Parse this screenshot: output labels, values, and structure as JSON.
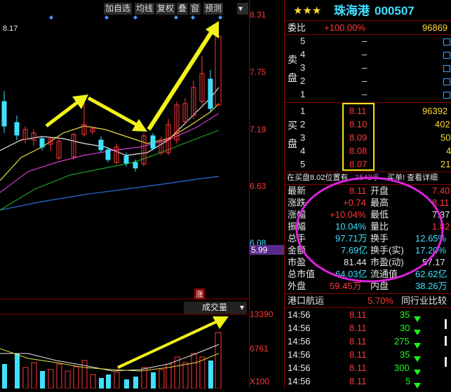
{
  "toolbar": {
    "buttons": [
      "加自选",
      "均线",
      "复权",
      "叠",
      "窗",
      "预测"
    ],
    "menu_icon": "triangle-down"
  },
  "chart": {
    "price_labels": [
      "8.31",
      "7.75",
      "7.19",
      "6.63",
      "6.08",
      "5.99"
    ],
    "high_mark": "8.17",
    "zhang_badge": "涨",
    "volume_title": "成交量",
    "volume_labels": [
      "13390",
      "6761",
      "X100"
    ]
  },
  "quote": {
    "stars": "★★★",
    "name": "珠海港",
    "code": "000507",
    "weibi_label": "委比",
    "weibi_value": "+100.00%",
    "weibi_diff": "96869",
    "sell_label": "卖盘",
    "sell_rows": [
      {
        "idx": "5",
        "price": "–",
        "vol": ""
      },
      {
        "idx": "4",
        "price": "–",
        "vol": ""
      },
      {
        "idx": "3",
        "price": "–",
        "vol": ""
      },
      {
        "idx": "2",
        "price": "–",
        "vol": ""
      },
      {
        "idx": "1",
        "price": "–",
        "vol": ""
      }
    ],
    "buy_label": "买盘",
    "buy_rows": [
      {
        "idx": "1",
        "price": "8.11",
        "vol": "96392"
      },
      {
        "idx": "2",
        "price": "8.10",
        "vol": "402"
      },
      {
        "idx": "3",
        "price": "8.09",
        "vol": "50"
      },
      {
        "idx": "4",
        "price": "8.08",
        "vol": "4"
      },
      {
        "idx": "5",
        "price": "8.07",
        "vol": "21"
      }
    ],
    "info_line_a": "在买盘8.02位置有",
    "info_line_b": "1542手",
    "info_line_c": "买单! 查看详细",
    "stats": [
      {
        "l1": "最新",
        "v1": "8.11",
        "l2": "开盘",
        "v2": "7.40"
      },
      {
        "l1": "涨跌",
        "v1": "+0.74",
        "l2": "最高",
        "v2": "8.11"
      },
      {
        "l1": "涨幅",
        "v1": "+10.04%",
        "l2": "最低",
        "v2": "7.37"
      },
      {
        "l1": "振幅",
        "v1": "10.04%",
        "l2": "量比",
        "v2": "1.82"
      },
      {
        "l1": "总手",
        "v1": "97.71万",
        "l2": "换手",
        "v2": "12.65%"
      },
      {
        "l1": "金额",
        "v1": "7.69亿",
        "l2": "换手(实)",
        "v2": "17.20%"
      },
      {
        "l1": "市盈",
        "v1": "81.44",
        "l2": "市盈(动)",
        "v2": "57.17"
      },
      {
        "l1": "总市值",
        "v1": "64.03亿",
        "l2": "流通值",
        "v2": "62.62亿"
      },
      {
        "l1": "外盘",
        "v1": "59.45万",
        "l2": "内盘",
        "v2": "38.26万"
      }
    ],
    "sector_name": "港口航运",
    "sector_pct": "5.70%",
    "sector_compare": "同行业比较",
    "ticks": [
      {
        "time": "14:56",
        "price": "8.11",
        "vol": "35"
      },
      {
        "time": "14:56",
        "price": "8.11",
        "vol": "30"
      },
      {
        "time": "14:56",
        "price": "8.11",
        "vol": "275"
      },
      {
        "time": "14:56",
        "price": "8.11",
        "vol": "35"
      },
      {
        "time": "14:56",
        "price": "8.11",
        "vol": "300"
      },
      {
        "time": "14:56",
        "price": "8.11",
        "vol": "5"
      }
    ]
  },
  "colors": {
    "up": "#ff3a3a",
    "down": "#3fe0ff",
    "accent": "#ffdc32",
    "circle": "#e020e0"
  }
}
